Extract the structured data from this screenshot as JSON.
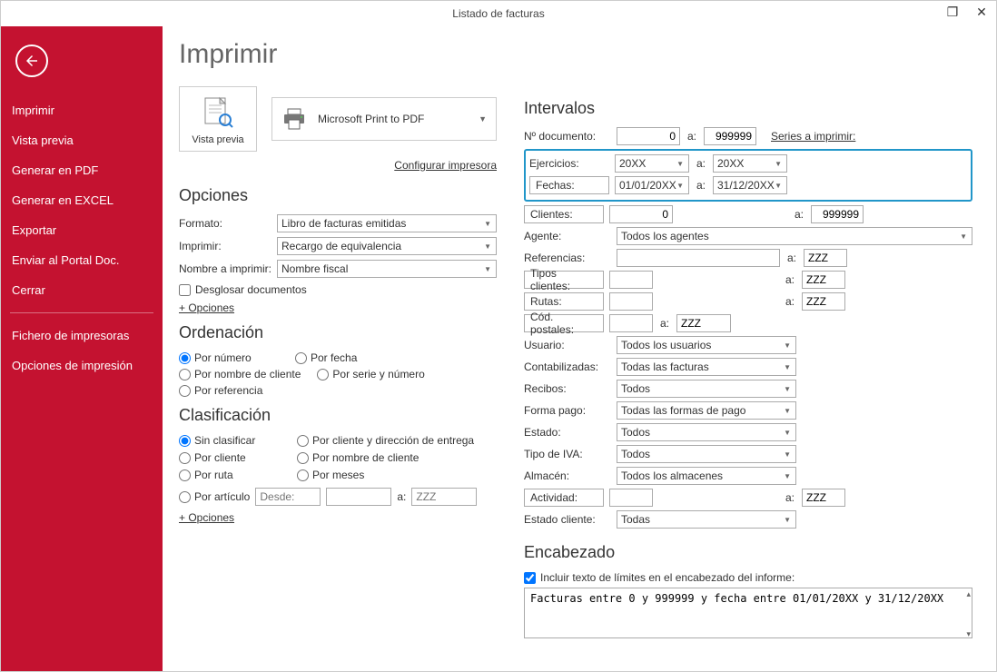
{
  "window": {
    "title": "Listado de facturas"
  },
  "sidebar": {
    "items": [
      "Imprimir",
      "Vista previa",
      "Generar en PDF",
      "Generar en EXCEL",
      "Exportar",
      "Enviar al Portal Doc.",
      "Cerrar"
    ],
    "items2": [
      "Fichero de impresoras",
      "Opciones de impresión"
    ]
  },
  "page": {
    "title": "Imprimir",
    "vista_previa": "Vista previa",
    "printer": "Microsoft Print to PDF",
    "config_link": "Configurar impresora"
  },
  "opciones": {
    "title": "Opciones",
    "formato_label": "Formato:",
    "formato_value": "Libro de facturas emitidas",
    "imprimir_label": "Imprimir:",
    "imprimir_value": "Recargo de equivalencia",
    "nombre_label": "Nombre a imprimir:",
    "nombre_value": "Nombre fiscal",
    "desglosar": "Desglosar documentos",
    "more": "+ Opciones"
  },
  "ordenacion": {
    "title": "Ordenación",
    "opts": [
      "Por número",
      "Por fecha",
      "Por nombre de cliente",
      "Por serie y número",
      "Por referencia"
    ]
  },
  "clasificacion": {
    "title": "Clasificación",
    "rows": [
      [
        "Sin clasificar",
        "Por cliente y dirección de entrega"
      ],
      [
        "Por cliente",
        "Por nombre de cliente"
      ],
      [
        "Por ruta",
        "Por meses"
      ]
    ],
    "articulo": "Por artículo",
    "desde": "Desde:",
    "a": "a:",
    "zzz": "ZZZ",
    "more": "+ Opciones"
  },
  "intervalos": {
    "title": "Intervalos",
    "ndoc_label": "Nº documento:",
    "ndoc_from": "0",
    "a": "a:",
    "ndoc_to": "999999",
    "series_link": "Series a imprimir:",
    "ejercicios_label": "Ejercicios:",
    "ejercicios_from": "20XX",
    "ejercicios_to": "20XX",
    "fechas_label": "Fechas:",
    "fechas_from": "01/01/20XX",
    "fechas_to": "31/12/20XX",
    "clientes_label": "Clientes:",
    "clientes_from": "0",
    "clientes_to": "999999",
    "agente_label": "Agente:",
    "agente_value": "Todos los agentes",
    "referencias_label": "Referencias:",
    "zzz": "ZZZ",
    "tipos_clientes_label": "Tipos clientes:",
    "rutas_label": "Rutas:",
    "cod_postales_label": "Cód. postales:",
    "usuario_label": "Usuario:",
    "usuario_value": "Todos los usuarios",
    "contabilizadas_label": "Contabilizadas:",
    "contabilizadas_value": "Todas las facturas",
    "recibos_label": "Recibos:",
    "recibos_value": "Todos",
    "forma_pago_label": "Forma pago:",
    "forma_pago_value": "Todas las formas de pago",
    "estado_label": "Estado:",
    "estado_value": "Todos",
    "tipo_iva_label": "Tipo de IVA:",
    "tipo_iva_value": "Todos",
    "almacen_label": "Almacén:",
    "almacen_value": "Todos los almacenes",
    "actividad_label": "Actividad:",
    "estado_cliente_label": "Estado cliente:",
    "estado_cliente_value": "Todas"
  },
  "encabezado": {
    "title": "Encabezado",
    "check_label": "Incluir texto de límites en el encabezado del informe:",
    "text": "Facturas entre 0 y 999999 y fecha entre 01/01/20XX y 31/12/20XX"
  }
}
